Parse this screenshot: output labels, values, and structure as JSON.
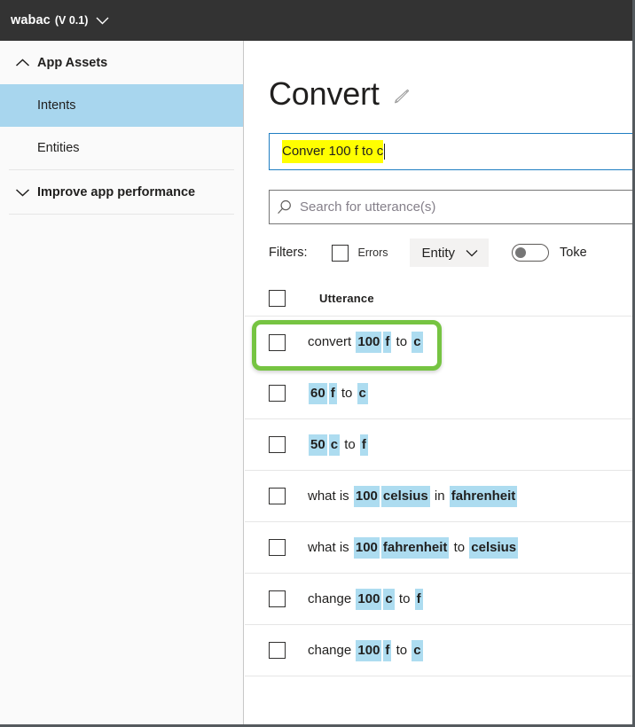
{
  "topbar": {
    "app_name": "wabac",
    "version": "(V 0.1)",
    "chevron_icon": "chevron-down-icon"
  },
  "sidebar": {
    "groups": [
      {
        "label": "App Assets",
        "chevron_icon": "chevron-up-icon",
        "expanded": true,
        "items": [
          {
            "label": "Intents",
            "selected": true
          },
          {
            "label": "Entities",
            "selected": false
          }
        ]
      },
      {
        "label": "Improve app performance",
        "chevron_icon": "chevron-down-icon",
        "expanded": false,
        "items": []
      }
    ],
    "selected_color": "#a8d6ee"
  },
  "main": {
    "page_title": "Convert",
    "edit_icon": "pencil-icon",
    "entry_input": {
      "value": "Conver 100 f to c",
      "highlight_color": "#ffff00",
      "border_color": "#1f7ec2",
      "has_caret": true
    },
    "search": {
      "icon": "search-icon",
      "placeholder": "Search for utterance(s)",
      "value": ""
    },
    "filters": {
      "label": "Filters:",
      "errors_checkbox": {
        "label": "Errors",
        "checked": false
      },
      "entity_dropdown": {
        "label": "Entity",
        "chevron_icon": "chevron-down-icon"
      },
      "toggle": {
        "on": false
      },
      "toggle_label": "Toke"
    },
    "table": {
      "select_all_checked": false,
      "columns": [
        "Utterance"
      ],
      "entity_highlight_color": "#addcf0",
      "row_highlight_color": "#76c442",
      "rows": [
        {
          "checked": false,
          "highlighted": true,
          "tokens": [
            {
              "text": "convert ",
              "entity": false
            },
            {
              "text": "100",
              "entity": true
            },
            {
              "text": "f",
              "entity": true
            },
            {
              "text": " to ",
              "entity": false
            },
            {
              "text": "c",
              "entity": true
            }
          ]
        },
        {
          "checked": false,
          "highlighted": false,
          "tokens": [
            {
              "text": "60",
              "entity": true
            },
            {
              "text": "f",
              "entity": true
            },
            {
              "text": " to ",
              "entity": false
            },
            {
              "text": "c",
              "entity": true
            }
          ]
        },
        {
          "checked": false,
          "highlighted": false,
          "tokens": [
            {
              "text": "50",
              "entity": true
            },
            {
              "text": "c",
              "entity": true
            },
            {
              "text": " to ",
              "entity": false
            },
            {
              "text": "f",
              "entity": true
            }
          ]
        },
        {
          "checked": false,
          "highlighted": false,
          "tokens": [
            {
              "text": "what is ",
              "entity": false
            },
            {
              "text": "100",
              "entity": true
            },
            {
              "text": "celsius",
              "entity": true
            },
            {
              "text": " in ",
              "entity": false
            },
            {
              "text": "fahrenheit",
              "entity": true
            }
          ]
        },
        {
          "checked": false,
          "highlighted": false,
          "tokens": [
            {
              "text": "what is ",
              "entity": false
            },
            {
              "text": "100",
              "entity": true
            },
            {
              "text": "fahrenheit",
              "entity": true
            },
            {
              "text": " to ",
              "entity": false
            },
            {
              "text": "celsius",
              "entity": true
            }
          ]
        },
        {
          "checked": false,
          "highlighted": false,
          "tokens": [
            {
              "text": "change ",
              "entity": false
            },
            {
              "text": "100",
              "entity": true
            },
            {
              "text": "c",
              "entity": true
            },
            {
              "text": " to ",
              "entity": false
            },
            {
              "text": "f",
              "entity": true
            }
          ]
        },
        {
          "checked": false,
          "highlighted": false,
          "tokens": [
            {
              "text": "change ",
              "entity": false
            },
            {
              "text": "100",
              "entity": true
            },
            {
              "text": "f",
              "entity": true
            },
            {
              "text": " to ",
              "entity": false
            },
            {
              "text": "c",
              "entity": true
            }
          ]
        }
      ]
    }
  }
}
